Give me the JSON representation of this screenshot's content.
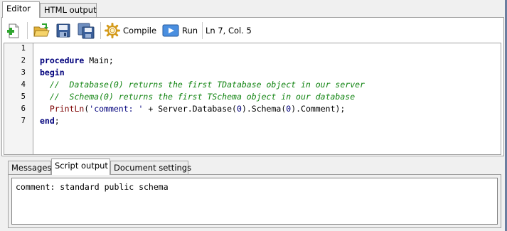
{
  "tabs": {
    "editor": "Editor",
    "html_output": "HTML output"
  },
  "toolbar": {
    "compile_label": "Compile",
    "run_label": "Run",
    "position": "Ln 7, Col. 5"
  },
  "editor": {
    "line_numbers": [
      "1",
      "2",
      "3",
      "4",
      "5",
      "6",
      "7"
    ],
    "lines": [
      {
        "segments": []
      },
      {
        "segments": [
          {
            "type": "kw",
            "text": "procedure"
          },
          {
            "type": "plain",
            "text": " Main;"
          }
        ]
      },
      {
        "segments": [
          {
            "type": "kw",
            "text": "begin"
          }
        ]
      },
      {
        "segments": [
          {
            "type": "plain",
            "text": "  "
          },
          {
            "type": "cm",
            "text": "//  Database(0) returns the first TDatabase object in our server"
          }
        ]
      },
      {
        "segments": [
          {
            "type": "plain",
            "text": "  "
          },
          {
            "type": "cm",
            "text": "//  Schema(0) returns the first TSchema object in our database"
          }
        ]
      },
      {
        "segments": [
          {
            "type": "plain",
            "text": "  "
          },
          {
            "type": "fn",
            "text": "PrintLn"
          },
          {
            "type": "plain",
            "text": "("
          },
          {
            "type": "str",
            "text": "'comment: '"
          },
          {
            "type": "plain",
            "text": " + Server.Database("
          },
          {
            "type": "str",
            "text": "0"
          },
          {
            "type": "plain",
            "text": ").Schema("
          },
          {
            "type": "str",
            "text": "0"
          },
          {
            "type": "plain",
            "text": ").Comment);"
          }
        ]
      },
      {
        "segments": [
          {
            "type": "kw",
            "text": "end"
          },
          {
            "type": "plain",
            "text": ";"
          }
        ]
      }
    ]
  },
  "bottom_tabs": {
    "messages": "Messages",
    "script_output": "Script output",
    "document_settings": "Document settings"
  },
  "output": {
    "text": "comment: standard public schema"
  }
}
